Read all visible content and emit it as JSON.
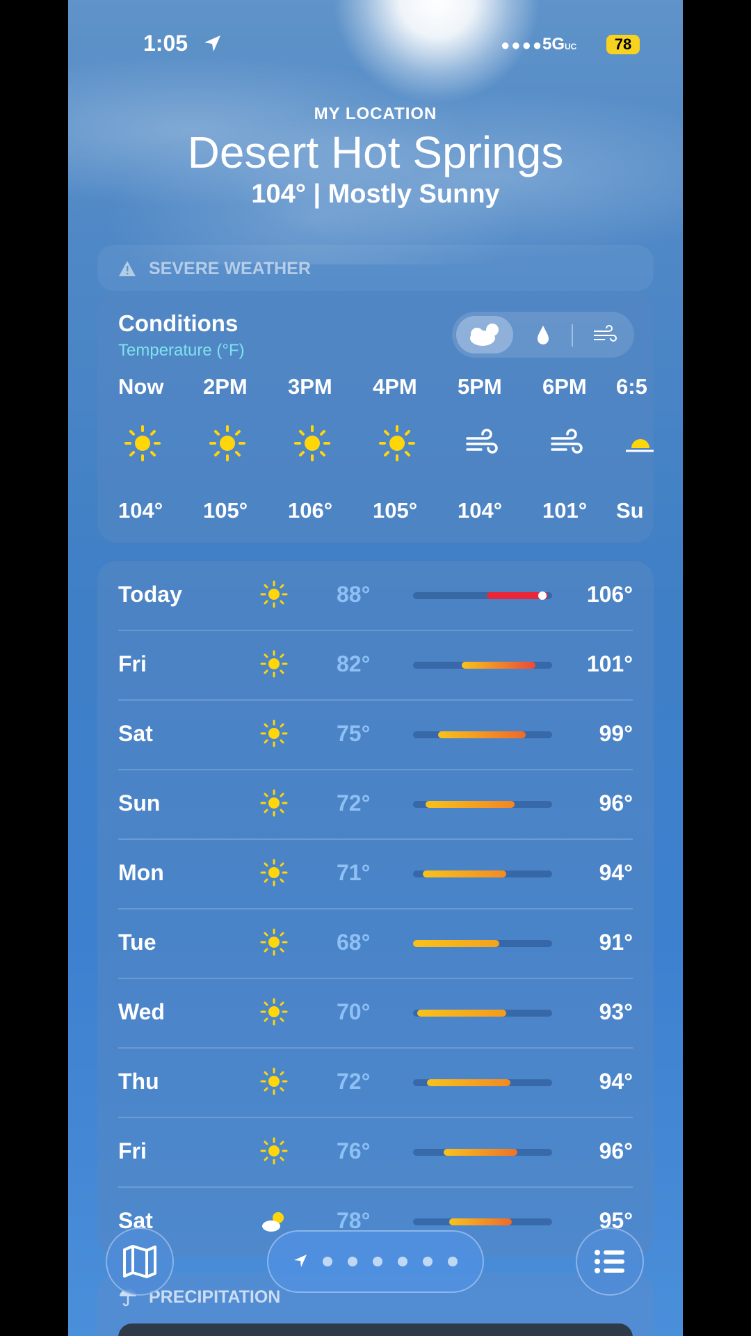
{
  "status": {
    "time": "1:05",
    "network": "5G",
    "network_sub": "UC",
    "battery": "78"
  },
  "header": {
    "label": "MY LOCATION",
    "city": "Desert Hot Springs",
    "summary": "104°  |  Mostly Sunny"
  },
  "severe": {
    "label": "SEVERE WEATHER"
  },
  "conditions": {
    "title": "Conditions",
    "subtitle": "Temperature (°F)",
    "hours": [
      {
        "label": "Now",
        "icon": "sun-icon",
        "temp": "104°"
      },
      {
        "label": "2PM",
        "icon": "sun-icon",
        "temp": "105°"
      },
      {
        "label": "3PM",
        "icon": "sun-icon",
        "temp": "106°"
      },
      {
        "label": "4PM",
        "icon": "sun-icon",
        "temp": "105°"
      },
      {
        "label": "5PM",
        "icon": "wind-icon",
        "temp": "104°"
      },
      {
        "label": "6PM",
        "icon": "wind-icon",
        "temp": "101°"
      },
      {
        "label": "6:5",
        "icon": "sunset-icon",
        "temp": "Su"
      }
    ]
  },
  "daily": [
    {
      "day": "Today",
      "lo": "88°",
      "hi": "106°",
      "bar": [
        0.53,
        0.97
      ],
      "current": 0.93,
      "color": "#e8283a"
    },
    {
      "day": "Fri",
      "lo": "82°",
      "hi": "101°",
      "bar": [
        0.35,
        0.88
      ],
      "color": "#ec4a36"
    },
    {
      "day": "Sat",
      "lo": "75°",
      "hi": "99°",
      "bar": [
        0.18,
        0.81
      ],
      "color": "#ee6a2a"
    },
    {
      "day": "Sun",
      "lo": "72°",
      "hi": "96°",
      "bar": [
        0.09,
        0.73
      ],
      "color": "#f28524"
    },
    {
      "day": "Mon",
      "lo": "71°",
      "hi": "94°",
      "bar": [
        0.07,
        0.67
      ],
      "color": "#f28b23"
    },
    {
      "day": "Tue",
      "lo": "68°",
      "hi": "91°",
      "bar": [
        0.0,
        0.62
      ],
      "color": "#f5a21c"
    },
    {
      "day": "Wed",
      "lo": "70°",
      "hi": "93°",
      "bar": [
        0.03,
        0.67
      ],
      "color": "#f39a1d"
    },
    {
      "day": "Thu",
      "lo": "72°",
      "hi": "94°",
      "bar": [
        0.1,
        0.7
      ],
      "color": "#f28a24"
    },
    {
      "day": "Fri",
      "lo": "76°",
      "hi": "96°",
      "bar": [
        0.22,
        0.75
      ],
      "color": "#ef7228"
    },
    {
      "day": "Sat",
      "lo": "78°",
      "hi": "95°",
      "bar": [
        0.26,
        0.71
      ],
      "color": "#ee6a2a",
      "icon": "partly-sunny-icon"
    }
  ],
  "precipitation": {
    "label": "PRECIPITATION"
  }
}
